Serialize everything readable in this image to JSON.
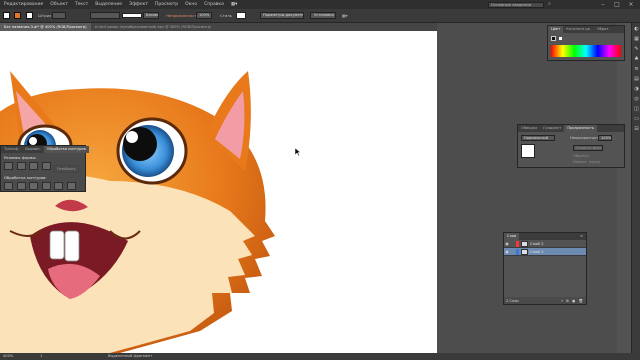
{
  "menubar": {
    "items": [
      "Редактирование",
      "Объект",
      "Текст",
      "Выделение",
      "Эффект",
      "Просмотр",
      "Окно",
      "Справка"
    ],
    "bridge_icon": "Br",
    "arrange_icon": "layout-icon",
    "workspace": "Основные сведения",
    "search_icon": "search-icon"
  },
  "controlbar": {
    "stroke_label": "Штрих",
    "style_value": "Базовая",
    "opacity_label": "Непрозрачность",
    "opacity_value": "100%",
    "style_label": "Стиль",
    "doc_setup": "Параметры документа",
    "prefs": "Установки"
  },
  "tabs": [
    {
      "label": "Без названия-3.ai* @ 400% (RGB/Просмотр)",
      "active": true
    },
    {
      "label": "ai lord хомяк (преобразованный).eps @ 300% (RGB/Просмотр)",
      "active": false
    }
  ],
  "pathfinder": {
    "tabs": [
      "Трансф.",
      "Выравн.",
      "Обработка контуров"
    ],
    "shape_modes_title": "Режимы формы:",
    "expand_label": "Разобрать",
    "pathfinders_title": "Обработка контуров:",
    "mode_buttons": [
      "unite",
      "minus-front",
      "intersect",
      "exclude"
    ],
    "pf_buttons": [
      "divide",
      "trim",
      "merge",
      "crop",
      "outline",
      "minus-back"
    ]
  },
  "color_panel": {
    "tabs": [
      "Цвет",
      "Каталоги цв.",
      "Образ."
    ]
  },
  "transparency": {
    "tabs": [
      "Обводка",
      "Градиент",
      "Прозрачность"
    ],
    "blend_mode": "Нормальный",
    "opacity_label": "Непрозрачность",
    "opacity_value": "100%",
    "make_mask": "Создать маску",
    "clip_label": "Обрезка",
    "invert_label": "Инверт. маску"
  },
  "layers": {
    "title": "Слои",
    "rows": [
      {
        "name": "Слой 2",
        "color": "#ff3333",
        "selected": false
      },
      {
        "name": "Слой 1",
        "color": "#3a78d6",
        "selected": true
      }
    ],
    "footer": "2 Слои"
  },
  "status": {
    "zoom": "400%",
    "page": "1",
    "tool": "Выделенный фрагмент"
  },
  "colors": {
    "ui_dark": "#2f2f2f",
    "panel": "#535353",
    "canvas": "#ffffff",
    "accent_link": "#e08a6a",
    "layer_selected": "#6d8bb0"
  }
}
